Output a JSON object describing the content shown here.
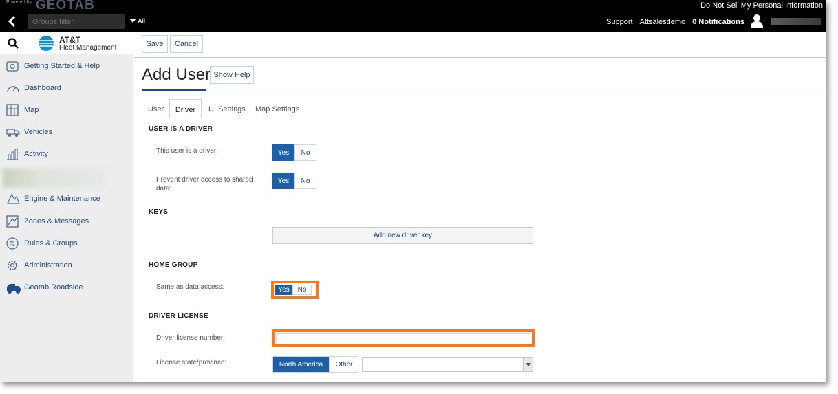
{
  "topbar": {
    "powered_by": "Powered by",
    "brand": "GEOTAB",
    "do_not_sell": "Do Not Sell My Personal Information"
  },
  "navbar": {
    "groups_filter_placeholder": "Groups filter",
    "groups_all": "All",
    "support": "Support",
    "account": "Attsalesdemo",
    "notifications": "0 Notifications"
  },
  "sidebar": {
    "logo_title": "AT&T",
    "logo_subtitle": "Fleet Management",
    "items": [
      {
        "label": "Getting Started & Help",
        "icon": "help-box-icon"
      },
      {
        "label": "Dashboard",
        "icon": "gauge-icon"
      },
      {
        "label": "Map",
        "icon": "map-icon"
      },
      {
        "label": "Vehicles",
        "icon": "truck-icon"
      },
      {
        "label": "Activity",
        "icon": "chart-icon"
      },
      {
        "label": "Engine & Maintenance",
        "icon": "engine-icon"
      },
      {
        "label": "Zones & Messages",
        "icon": "zone-icon"
      },
      {
        "label": "Rules & Groups",
        "icon": "rules-icon"
      },
      {
        "label": "Administration",
        "icon": "gear-icon"
      },
      {
        "label": "Geotab Roadside",
        "icon": "roadside-truck-icon"
      }
    ]
  },
  "toolbar": {
    "save_label": "Save",
    "cancel_label": "Cancel"
  },
  "page": {
    "title": "Add User",
    "show_help": "Show Help"
  },
  "tabs": [
    {
      "label": "User",
      "active": false
    },
    {
      "label": "Driver",
      "active": true
    },
    {
      "label": "UI Settings",
      "active": false
    },
    {
      "label": "Map Settings",
      "active": false
    }
  ],
  "form": {
    "driver_section": "USER IS A DRIVER",
    "is_driver_label": "This user is a driver:",
    "prevent_access_label": "Prevent driver access to shared data:",
    "yes": "Yes",
    "no": "No",
    "keys_section": "KEYS",
    "add_key": "Add new driver key",
    "home_group_section": "HOME GROUP",
    "same_as_data_label": "Same as data access:",
    "license_section": "DRIVER LICENSE",
    "license_number_label": "Driver license number:",
    "license_number_value": "",
    "license_state_label": "License state/province:",
    "region_north_america": "North America",
    "region_other": "Other",
    "state_value": ""
  },
  "colors": {
    "accent": "#1f5fa6",
    "link": "#25477b",
    "highlight": "#f47920",
    "topbar": "#000000"
  }
}
